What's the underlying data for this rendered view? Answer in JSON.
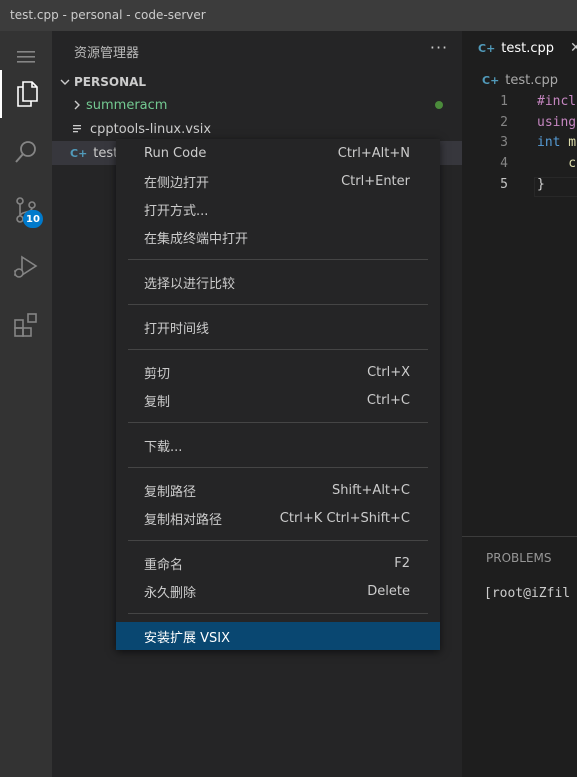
{
  "window": {
    "title": "test.cpp - personal - code-server"
  },
  "activity_bar": {
    "items": [
      {
        "name": "menu-icon"
      },
      {
        "name": "explorer-icon",
        "active": true
      },
      {
        "name": "search-icon"
      },
      {
        "name": "source-control-icon",
        "badge": "10"
      },
      {
        "name": "run-debug-icon"
      },
      {
        "name": "extensions-icon"
      }
    ]
  },
  "sidebar": {
    "title": "资源管理器",
    "more": "···",
    "section": "PERSONAL",
    "tree": [
      {
        "label": "summeracm",
        "type": "folder",
        "status_color": "#4b8b3b"
      },
      {
        "label": "cpptools-linux.vsix",
        "type": "file"
      },
      {
        "label": "test.",
        "type": "cpp"
      }
    ]
  },
  "editor": {
    "tab": {
      "label": "test.cpp",
      "close": "✕"
    },
    "breadcrumb": "test.cpp",
    "lines": [
      {
        "n": "1",
        "tokens": [
          {
            "t": "#incl",
            "c": "pp"
          }
        ]
      },
      {
        "n": "2",
        "tokens": [
          {
            "t": "using",
            "c": "pp"
          }
        ]
      },
      {
        "n": "3",
        "tokens": [
          {
            "t": "int",
            "c": "kw"
          },
          {
            "t": " m",
            "c": "id"
          }
        ]
      },
      {
        "n": "4",
        "tokens": [
          {
            "t": "    c",
            "c": "id"
          }
        ]
      },
      {
        "n": "5",
        "tokens": [
          {
            "t": "}",
            "c": "br"
          }
        ]
      }
    ],
    "current_line": "5"
  },
  "panel": {
    "title": "PROBLEMS",
    "terminal_text": "[root@iZfil"
  },
  "context_menu": {
    "items": [
      {
        "label": "Run Code",
        "shortcut": "Ctrl+Alt+N"
      },
      {
        "label": "在侧边打开",
        "shortcut": "Ctrl+Enter"
      },
      {
        "label": "打开方式...",
        "shortcut": ""
      },
      {
        "label": "在集成终端中打开",
        "shortcut": ""
      },
      {
        "separator": true
      },
      {
        "label": "选择以进行比较",
        "shortcut": ""
      },
      {
        "separator": true
      },
      {
        "label": "打开时间线",
        "shortcut": ""
      },
      {
        "separator": true
      },
      {
        "label": "剪切",
        "shortcut": "Ctrl+X"
      },
      {
        "label": "复制",
        "shortcut": "Ctrl+C"
      },
      {
        "separator": true
      },
      {
        "label": "下载...",
        "shortcut": ""
      },
      {
        "separator": true
      },
      {
        "label": "复制路径",
        "shortcut": "Shift+Alt+C"
      },
      {
        "label": "复制相对路径",
        "shortcut": "Ctrl+K Ctrl+Shift+C"
      },
      {
        "separator": true
      },
      {
        "label": "重命名",
        "shortcut": "F2"
      },
      {
        "label": "永久删除",
        "shortcut": "Delete"
      },
      {
        "separator": true
      },
      {
        "label": "安装扩展 VSIX",
        "shortcut": "",
        "selected": true
      }
    ]
  },
  "colors": {
    "accent": "#007acc",
    "menu_selection": "#094771",
    "folder_git": "#73c991",
    "cpp_icon": "#519aba"
  }
}
